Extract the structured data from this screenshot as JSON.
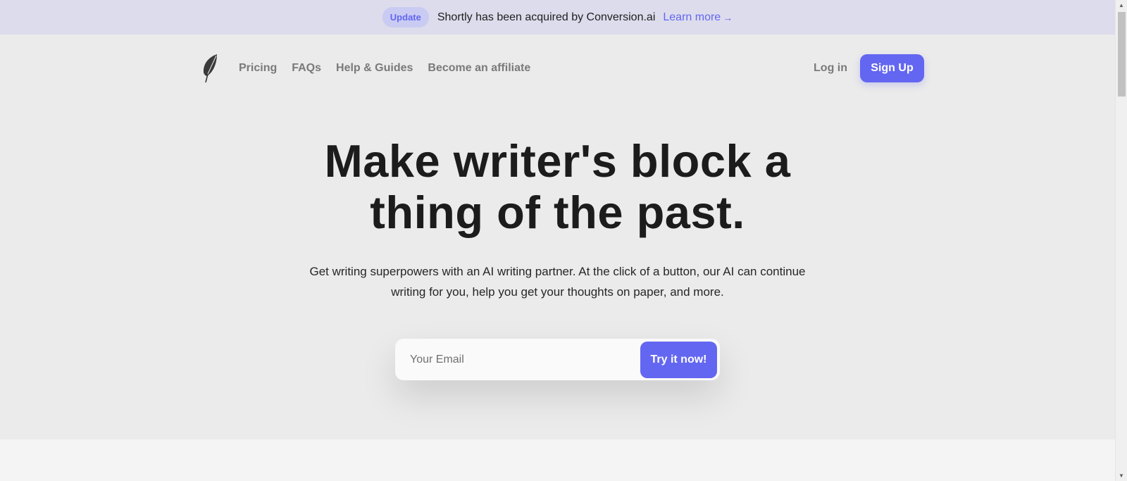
{
  "banner": {
    "badge": "Update",
    "text": "Shortly has been acquired by Conversion.ai",
    "link_label": "Learn more",
    "link_icon": "arrow-right-icon"
  },
  "nav": {
    "logo_icon": "feather-icon",
    "links": [
      "Pricing",
      "FAQs",
      "Help & Guides",
      "Become an affiliate"
    ],
    "login_label": "Log in",
    "signup_label": "Sign Up"
  },
  "hero": {
    "title_line1": "Make writer's block a",
    "title_line2": "thing of the past.",
    "subtitle_line1": "Get writing superpowers with an AI writing partner. At the click of a button, our AI can continue",
    "subtitle_line2": "writing for you, help you get your thoughts on paper, and more."
  },
  "cta": {
    "email_placeholder": "Your Email",
    "email_value": "",
    "button_label": "Try it now!"
  },
  "colors": {
    "accent": "#6366f1",
    "banner_bg": "#dcdcec",
    "page_bg": "#ebebeb"
  }
}
